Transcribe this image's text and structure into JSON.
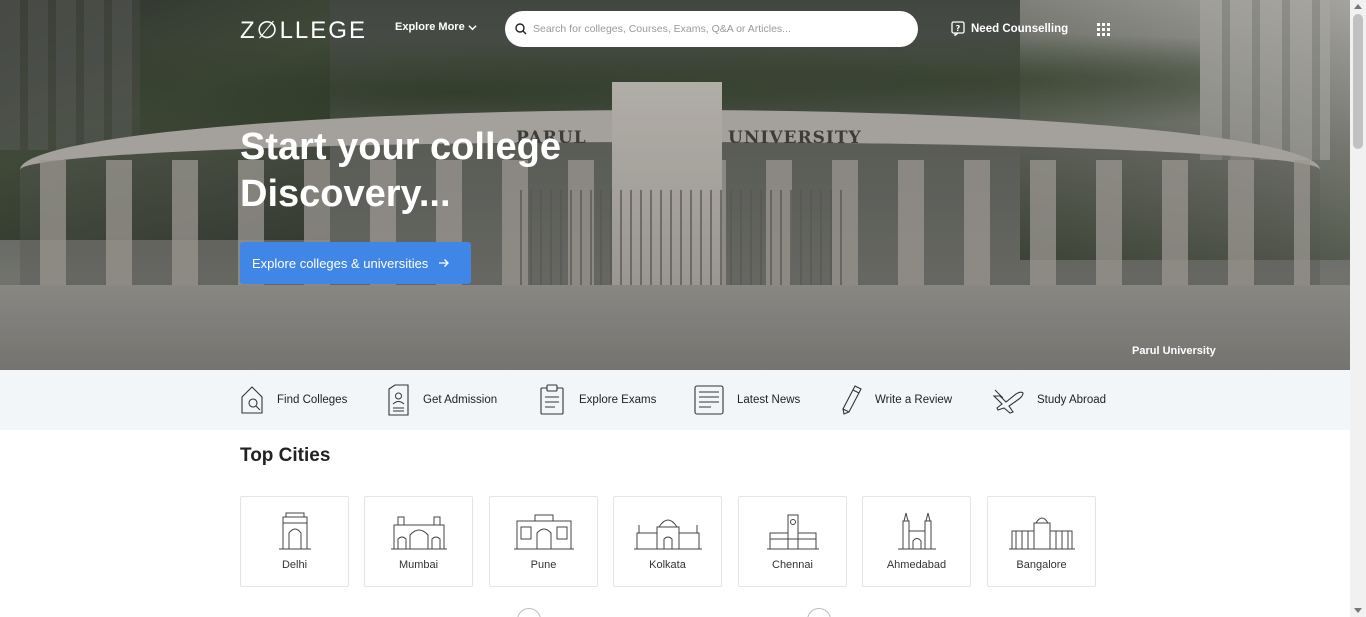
{
  "header": {
    "logo": "Z∅LLEGE",
    "explore_more": "Explore More",
    "search_placeholder": "Search for colleges, Courses, Exams, Q&A or Articles...",
    "need_counselling": "Need Counselling"
  },
  "hero": {
    "headline_line1": "Start your college",
    "headline_line2": "Discovery...",
    "cta_label": "Explore colleges & universities",
    "cta_color": "#3f86e6",
    "image_credit": "Parul University",
    "gate_text_left": "PARUL",
    "gate_text_right": "UNIVERSITY"
  },
  "quick_links": [
    {
      "label": "Find Colleges",
      "icon": "find-colleges-icon"
    },
    {
      "label": "Get Admission",
      "icon": "admission-form-icon"
    },
    {
      "label": "Explore Exams",
      "icon": "clipboard-icon"
    },
    {
      "label": "Latest News",
      "icon": "news-icon"
    },
    {
      "label": "Write a Review",
      "icon": "pen-icon"
    },
    {
      "label": "Study Abroad",
      "icon": "airplane-icon"
    }
  ],
  "top_cities": {
    "title": "Top Cities",
    "cities": [
      {
        "name": "Delhi",
        "icon": "india-gate-icon"
      },
      {
        "name": "Mumbai",
        "icon": "gateway-of-india-icon"
      },
      {
        "name": "Pune",
        "icon": "shaniwar-wada-icon"
      },
      {
        "name": "Kolkata",
        "icon": "victoria-memorial-icon"
      },
      {
        "name": "Chennai",
        "icon": "chennai-central-icon"
      },
      {
        "name": "Ahmedabad",
        "icon": "ahmedabad-mosque-icon"
      },
      {
        "name": "Bangalore",
        "icon": "vidhana-soudha-icon"
      }
    ]
  }
}
